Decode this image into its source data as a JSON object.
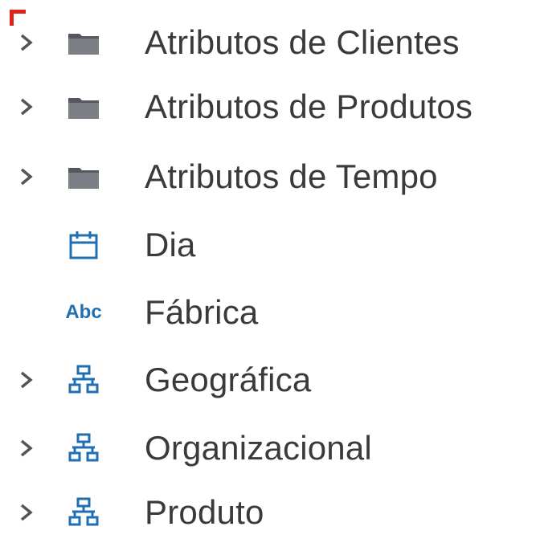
{
  "tree": {
    "items": [
      {
        "label": "Atributos de Clientes",
        "icon": "folder-icon",
        "expandable": true
      },
      {
        "label": "Atributos de Produtos",
        "icon": "folder-icon",
        "expandable": true
      },
      {
        "label": "Atributos de Tempo",
        "icon": "folder-icon",
        "expandable": true
      },
      {
        "label": "Dia",
        "icon": "calendar-icon",
        "expandable": false
      },
      {
        "label": "Fábrica",
        "icon": "text-abc-icon",
        "icon_text": "Abc",
        "expandable": false
      },
      {
        "label": "Geográfica",
        "icon": "hierarchy-icon",
        "expandable": true
      },
      {
        "label": "Organizacional",
        "icon": "hierarchy-icon",
        "expandable": true
      },
      {
        "label": "Produto",
        "icon": "hierarchy-icon",
        "expandable": true
      }
    ]
  },
  "colors": {
    "folder": "#7c7f86",
    "accent_blue": "#1f6fb2",
    "chevron": "#555555",
    "text": "#3a3a3a",
    "corner_marker": "#e0231a"
  }
}
